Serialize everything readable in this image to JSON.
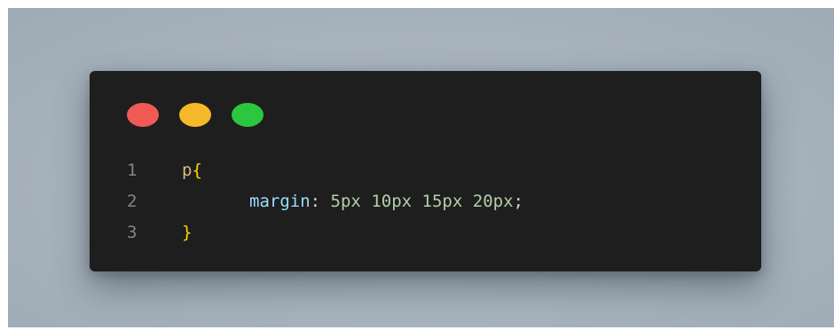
{
  "colors": {
    "close": "#f05a55",
    "minimize": "#f5b82a",
    "maximize": "#2cc640",
    "selector": "#d7ba7d",
    "brace": "#ffd700",
    "property": "#9cdcfe",
    "value": "#b5cea8",
    "punctuation": "#d4d4d4",
    "line_number": "#858585"
  },
  "window_controls": [
    "close",
    "minimize",
    "maximize"
  ],
  "code": {
    "language": "css",
    "lines": [
      {
        "number": "1",
        "selector": "p",
        "open_brace": "{"
      },
      {
        "number": "2",
        "property": "margin",
        "colon": ":",
        "values": [
          "5px",
          "10px",
          "15px",
          "20px"
        ],
        "semicolon": ";"
      },
      {
        "number": "3",
        "close_brace": "}"
      }
    ]
  }
}
